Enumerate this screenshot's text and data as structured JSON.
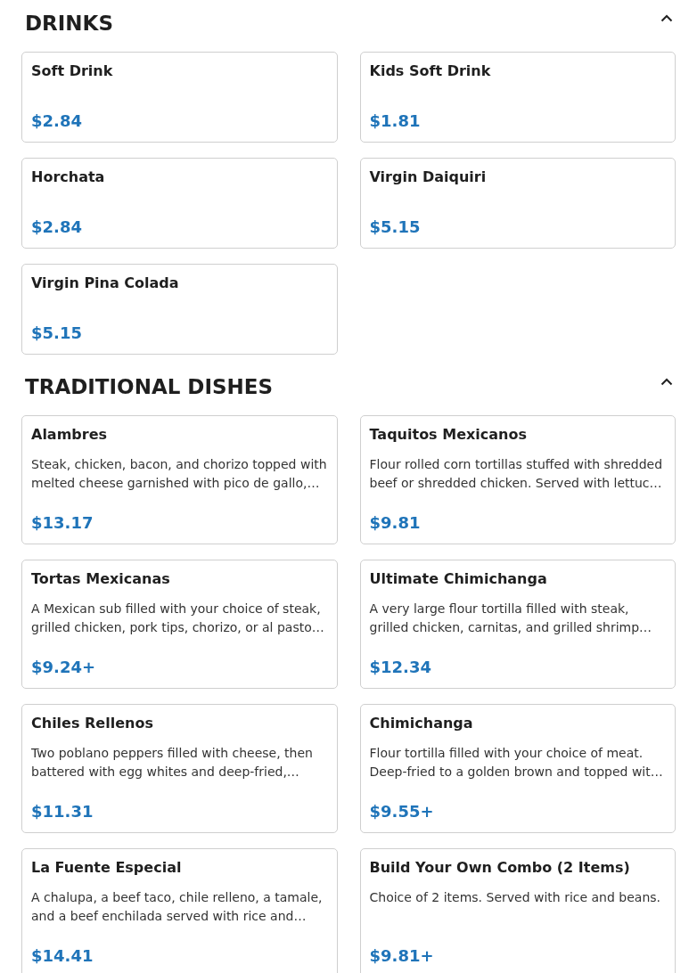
{
  "sections": [
    {
      "title": "DRINKS",
      "expanded": true,
      "items": [
        {
          "name": "Soft Drink",
          "price": "$2.84"
        },
        {
          "name": "Kids Soft Drink",
          "price": "$1.81"
        },
        {
          "name": "Horchata",
          "price": "$2.84"
        },
        {
          "name": "Virgin Daiquiri",
          "price": "$5.15"
        },
        {
          "name": "Virgin Pina Colada",
          "price": "$5.15"
        }
      ]
    },
    {
      "title": "TRADITIONAL DISHES",
      "expanded": true,
      "items": [
        {
          "name": "Alambres",
          "description": "Steak, chicken, bacon, and chorizo topped with melted cheese garnished with pico de gallo,…",
          "price": "$13.17"
        },
        {
          "name": "Taquitos Mexicanos",
          "description": "Flour rolled corn tortillas stuffed with shredded beef or shredded chicken. Served with lettuc…",
          "price": "$9.81"
        },
        {
          "name": "Tortas Mexicanas",
          "description": "A Mexican sub filled with your choice of steak, grilled chicken, pork tips, chorizo, or al pasto…",
          "price": "$9.24+"
        },
        {
          "name": "Ultimate Chimichanga",
          "description": "A very large flour tortilla filled with steak, grilled chicken, carnitas, and grilled shrimp…",
          "price": "$12.34"
        },
        {
          "name": "Chiles Rellenos",
          "description": "Two poblano peppers filled with cheese, then battered with egg whites and deep-fried,…",
          "price": "$11.31"
        },
        {
          "name": "Chimichanga",
          "description": "Flour tortilla filled with your choice of meat. Deep-fried to a golden brown and topped wit…",
          "price": "$9.55+"
        },
        {
          "name": "La Fuente Especial",
          "description": "A chalupa, a beef taco, chile relleno, a tamale, and a beef enchilada served with rice and…",
          "price": "$14.41"
        },
        {
          "name": "Build Your Own Combo (2 Items)",
          "description": "Choice of 2 items. Served with rice and beans.",
          "price": "$9.81+"
        }
      ]
    }
  ]
}
